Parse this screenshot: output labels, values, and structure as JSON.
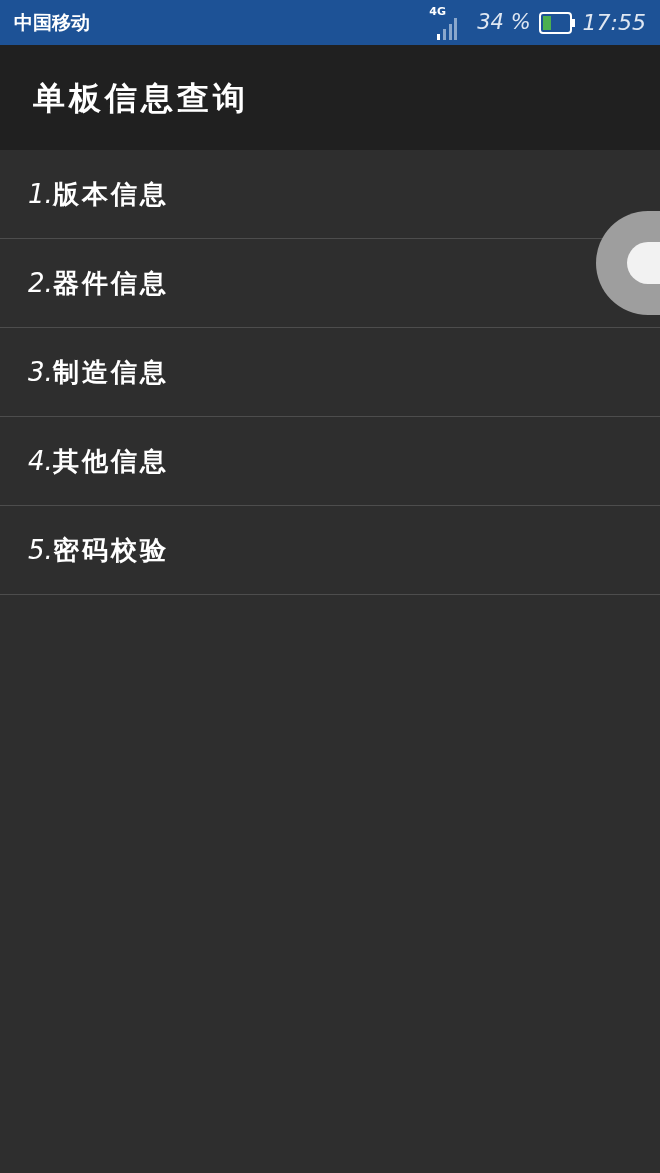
{
  "status_bar": {
    "carrier": "中国移动",
    "network": "4G",
    "battery_percent": "34 %",
    "time": "17:55"
  },
  "title": "单板信息查询",
  "menu": [
    {
      "number": "1.",
      "label": "版本信息"
    },
    {
      "number": "2.",
      "label": "器件信息"
    },
    {
      "number": "3.",
      "label": "制造信息"
    },
    {
      "number": "4.",
      "label": "其他信息"
    },
    {
      "number": "5.",
      "label": "密码校验"
    }
  ]
}
